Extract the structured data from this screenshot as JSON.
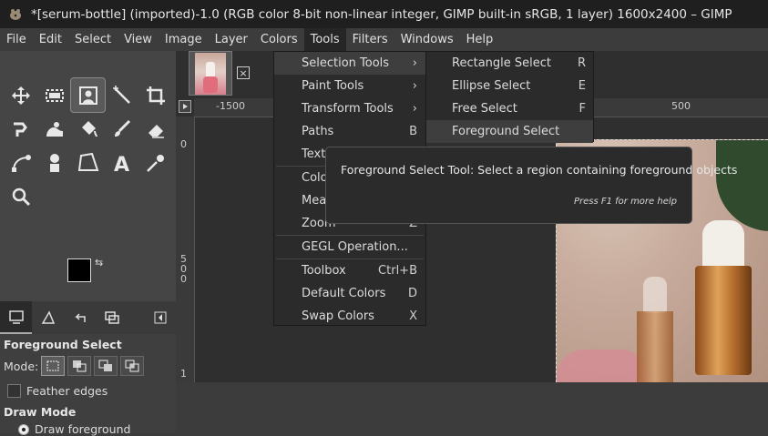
{
  "window": {
    "title": "*[serum-bottle] (imported)-1.0 (RGB color 8-bit non-linear integer, GIMP built-in sRGB, 1 layer) 1600x2400 – GIMP"
  },
  "menubar": {
    "items": [
      "File",
      "Edit",
      "Select",
      "View",
      "Image",
      "Layer",
      "Colors",
      "Tools",
      "Filters",
      "Windows",
      "Help"
    ],
    "active": "Tools"
  },
  "tools_menu": {
    "items": [
      {
        "label": "Selection Tools",
        "accel": "›",
        "highlighted": true
      },
      {
        "label": "Paint Tools",
        "accel": "›"
      },
      {
        "label": "Transform Tools",
        "accel": "›"
      },
      {
        "label": "Paths",
        "accel": "B"
      },
      {
        "label": "Text",
        "accel": ""
      },
      {
        "label": "Color",
        "accel": ""
      },
      {
        "label": "Meas",
        "accel": ""
      },
      {
        "label": "Zoom",
        "accel": "Z"
      },
      {
        "label": "GEGL Operation...",
        "accel": ""
      },
      {
        "label": "Toolbox",
        "accel": "Ctrl+B"
      },
      {
        "label": "Default Colors",
        "accel": "D"
      },
      {
        "label": "Swap Colors",
        "accel": "X"
      }
    ]
  },
  "selection_submenu": {
    "items": [
      {
        "label": "Rectangle Select",
        "accel": "R"
      },
      {
        "label": "Ellipse Select",
        "accel": "E"
      },
      {
        "label": "Free Select",
        "accel": "F"
      },
      {
        "label": "Foreground Select",
        "accel": "",
        "highlighted": true
      }
    ]
  },
  "tooltip": {
    "text": "Foreground Select Tool: Select a region containing foreground objects",
    "help": "Press F1 for more help"
  },
  "ruler": {
    "h_labels": [
      "-1500",
      "500"
    ],
    "v_labels": [
      "0",
      "5",
      "0",
      "0",
      "1"
    ]
  },
  "tool_options": {
    "title": "Foreground Select",
    "mode_label": "Mode:",
    "feather_label": "Feather edges",
    "draw_mode_label": "Draw Mode",
    "draw_foreground_label": "Draw foreground"
  },
  "colors": {
    "foreground": "#000000",
    "background": "#ffffff",
    "menu_bg": "#2b2b2b",
    "highlight": "#3e3e3e"
  },
  "icons": [
    "move-icon",
    "rect-select-icon",
    "foreground-select-icon",
    "fuzzy-select-icon",
    "crop-icon",
    "warp-icon",
    "smudge-icon",
    "bucket-fill-icon",
    "paintbrush-icon",
    "eraser-icon",
    "path-icon",
    "clone-icon",
    "perspective-icon",
    "text-icon",
    "color-picker-icon",
    "zoom-icon"
  ]
}
